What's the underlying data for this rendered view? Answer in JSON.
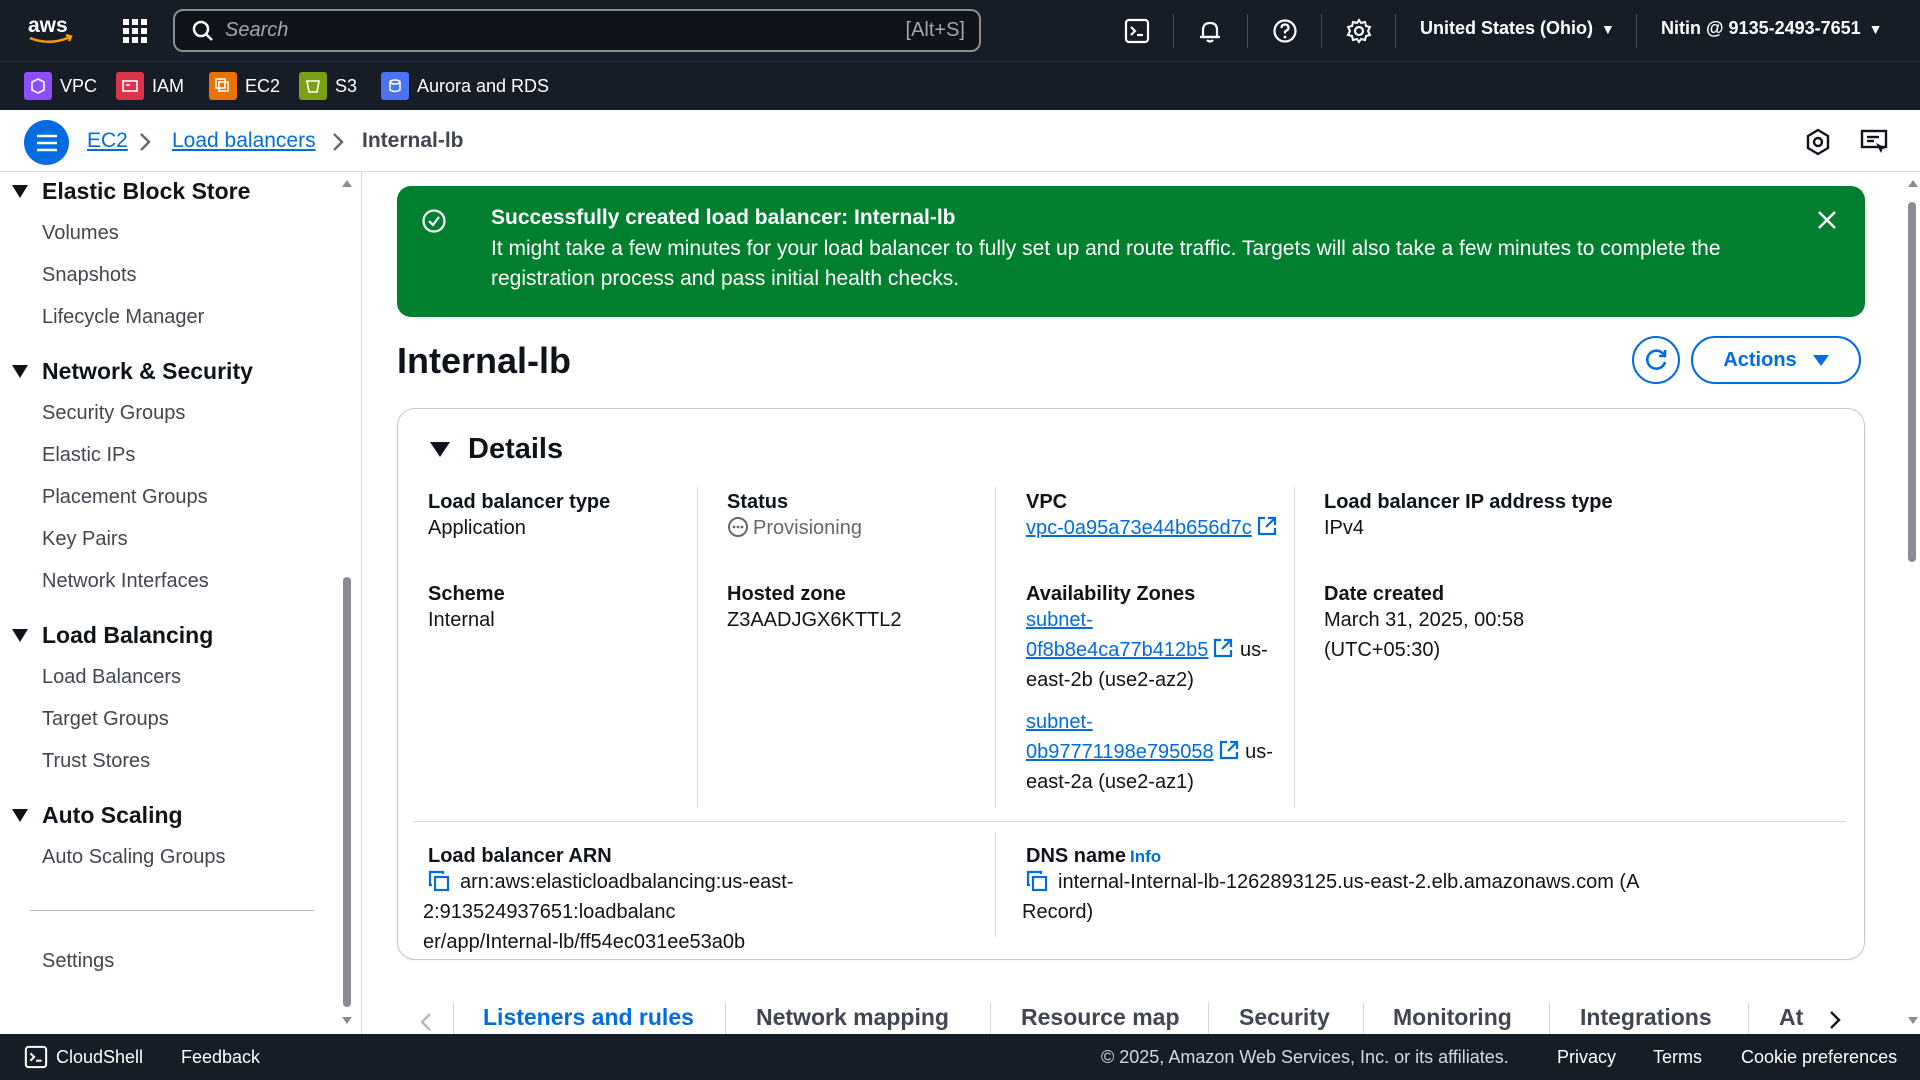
{
  "topnav": {
    "search_placeholder": "Search",
    "search_shortcut": "[Alt+S]",
    "region": "United States (Ohio)",
    "account": "Nitin @ 9135-2493-7651",
    "icons": [
      "cloudshell-icon",
      "bell-icon",
      "help-icon",
      "gear-icon"
    ]
  },
  "favorites": [
    {
      "label": "VPC",
      "color": "#8c4fff"
    },
    {
      "label": "IAM",
      "color": "#dd344c"
    },
    {
      "label": "EC2",
      "color": "#ed7100"
    },
    {
      "label": "S3",
      "color": "#7aa116"
    },
    {
      "label": "Aurora and RDS",
      "color": "#4d72f3"
    }
  ],
  "breadcrumb": {
    "items": [
      "EC2",
      "Load balancers"
    ],
    "current": "Internal-lb"
  },
  "sidebar": {
    "sections": [
      {
        "title": "Elastic Block Store",
        "items": [
          "Volumes",
          "Snapshots",
          "Lifecycle Manager"
        ]
      },
      {
        "title": "Network & Security",
        "items": [
          "Security Groups",
          "Elastic IPs",
          "Placement Groups",
          "Key Pairs",
          "Network Interfaces"
        ]
      },
      {
        "title": "Load Balancing",
        "items": [
          "Load Balancers",
          "Target Groups",
          "Trust Stores"
        ]
      },
      {
        "title": "Auto Scaling",
        "items": [
          "Auto Scaling Groups"
        ]
      }
    ],
    "settings": "Settings"
  },
  "flash": {
    "title": "Successfully created load balancer: Internal-lb",
    "message": "It might take a few minutes for your load balancer to fully set up and route traffic. Targets will also take a few minutes to complete the registration process and pass initial health checks."
  },
  "page": {
    "title": "Internal-lb",
    "actions_label": "Actions"
  },
  "details": {
    "heading": "Details",
    "lb_type_label": "Load balancer type",
    "lb_type": "Application",
    "status_label": "Status",
    "status": "Provisioning",
    "vpc_label": "VPC",
    "vpc": "vpc-0a95a73e44b656d7c",
    "ip_type_label": "Load balancer IP address type",
    "ip_type": "IPv4",
    "scheme_label": "Scheme",
    "scheme": "Internal",
    "hosted_zone_label": "Hosted zone",
    "hosted_zone": "Z3AADJGX6KTTL2",
    "az_label": "Availability Zones",
    "az": [
      {
        "subnet_a": "subnet-",
        "subnet_b": "0f8b8e4ca77b412b5",
        "suffix_a": "us-",
        "suffix_b": "east-2b (use2-az2)"
      },
      {
        "subnet_a": "subnet-",
        "subnet_b": "0b97771198e795058",
        "suffix_a": "us-",
        "suffix_b": "east-2a (use2-az1)"
      }
    ],
    "date_label": "Date created",
    "date_line1": "March 31, 2025, 00:58",
    "date_line2": "(UTC+05:30)",
    "arn_label": "Load balancer ARN",
    "arn_line1": "arn:aws:elasticloadbalancing:us-east-2:913524937651:loadbalanc",
    "arn_line2": "er/app/Internal-lb/ff54ec031ee53a0b",
    "dns_label": "DNS name",
    "dns_info": "Info",
    "dns_line1": "internal-Internal-lb-1262893125.us-east-2.elb.amazonaws.com (A",
    "dns_line2": "Record)"
  },
  "tabs": [
    "Listeners and rules",
    "Network mapping",
    "Resource map",
    "Security",
    "Monitoring",
    "Integrations",
    "At"
  ],
  "footer": {
    "cloudshell": "CloudShell",
    "feedback": "Feedback",
    "copyright": "© 2025, Amazon Web Services, Inc. or its affiliates.",
    "privacy": "Privacy",
    "terms": "Terms",
    "cookies": "Cookie preferences"
  },
  "colors": {
    "nav_bg": "#161d26",
    "link": "#006ce0",
    "success": "#00802f"
  }
}
